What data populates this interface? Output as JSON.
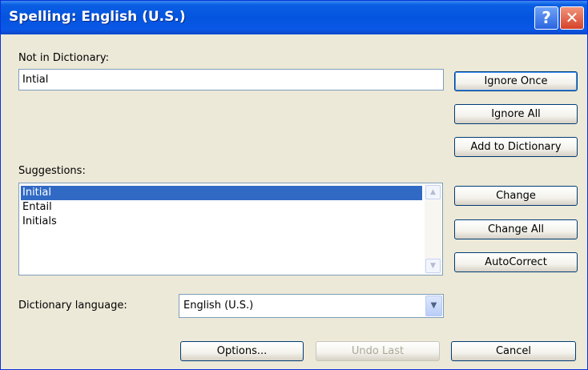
{
  "window": {
    "title": "Spelling: English (U.S.)",
    "help_glyph": "?",
    "close_glyph": "✕"
  },
  "not_in_dictionary": {
    "label": "Not in Dictionary:",
    "value": "Intial"
  },
  "suggestions": {
    "label": "Suggestions:",
    "items": [
      "Initial",
      "Entail",
      "Initials"
    ],
    "selected_index": 0
  },
  "dictionary_language": {
    "label": "Dictionary language:",
    "value": "English (U.S.)"
  },
  "buttons": {
    "ignore_once": "Ignore Once",
    "ignore_all": "Ignore All",
    "add_to_dictionary": "Add to Dictionary",
    "change": "Change",
    "change_all": "Change All",
    "autocorrect": "AutoCorrect",
    "options": "Options...",
    "undo_last": "Undo Last",
    "cancel": "Cancel"
  },
  "icons": {
    "scroll_up": "▲",
    "scroll_down": "▼",
    "dropdown": "▼"
  },
  "colors": {
    "titlebar": "#0454df",
    "selection": "#316ac5",
    "dialog_bg": "#ece9d8"
  }
}
